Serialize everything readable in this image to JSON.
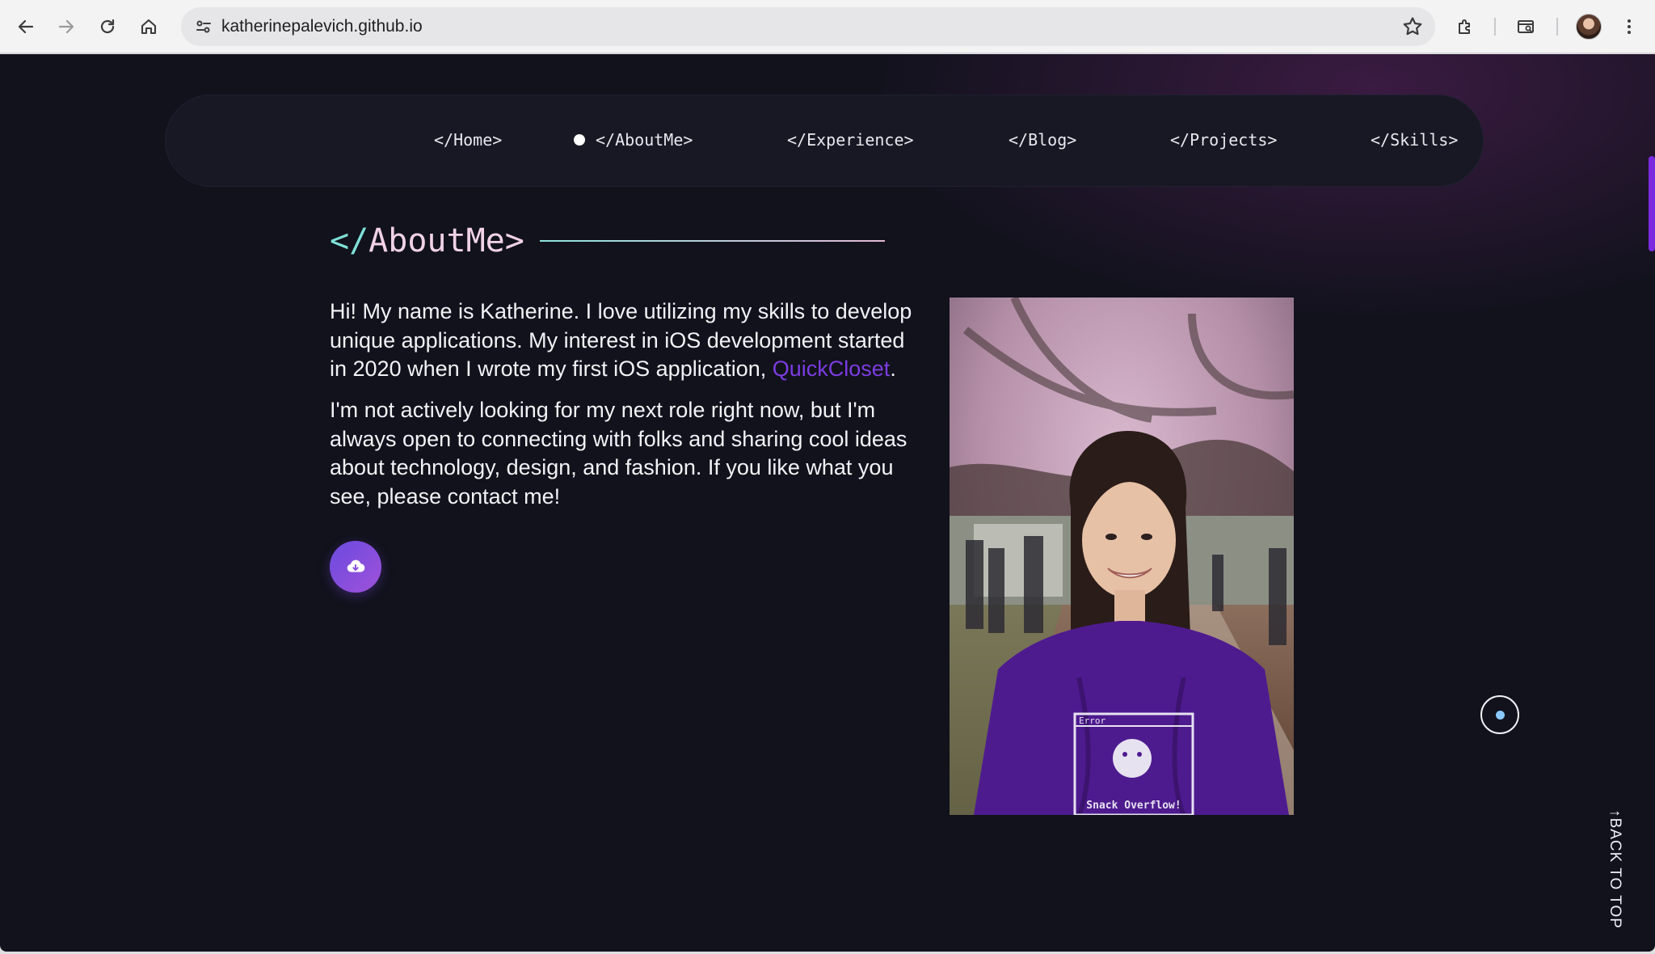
{
  "browser": {
    "url": "katherinepalevich.github.io",
    "back_icon": "arrow-left-icon",
    "forward_icon": "arrow-right-icon",
    "reload_icon": "reload-icon",
    "home_icon": "home-icon"
  },
  "nav": {
    "items": [
      "</Home>",
      "</AboutMe>",
      "</Experience>",
      "</Blog>",
      "</Projects>",
      "</Skills>"
    ],
    "active_index": 1
  },
  "section": {
    "slash": "</",
    "word": "AboutMe>"
  },
  "about": {
    "p1_before": "Hi! My name is Katherine. I love utilizing my skills to develop unique applications. My interest in iOS development started in 2020 when I wrote my first iOS application, ",
    "p1_link": "QuickCloset",
    "p1_after": ".",
    "p2": "I'm not actively looking for my next role right now, but I'm always open to connecting with folks and sharing cool ideas about technology, design, and fashion. If you like what you see, please contact me!"
  },
  "shirt": {
    "window_title": "Error",
    "caption": "Snack Overflow!"
  },
  "back_to_top": "↑BACK TO TOP",
  "colors": {
    "page_bg": "#11121c",
    "accent_purple": "#7c3ce0",
    "title_slash": "#7fe0d8",
    "title_word": "#f1d2e6"
  }
}
